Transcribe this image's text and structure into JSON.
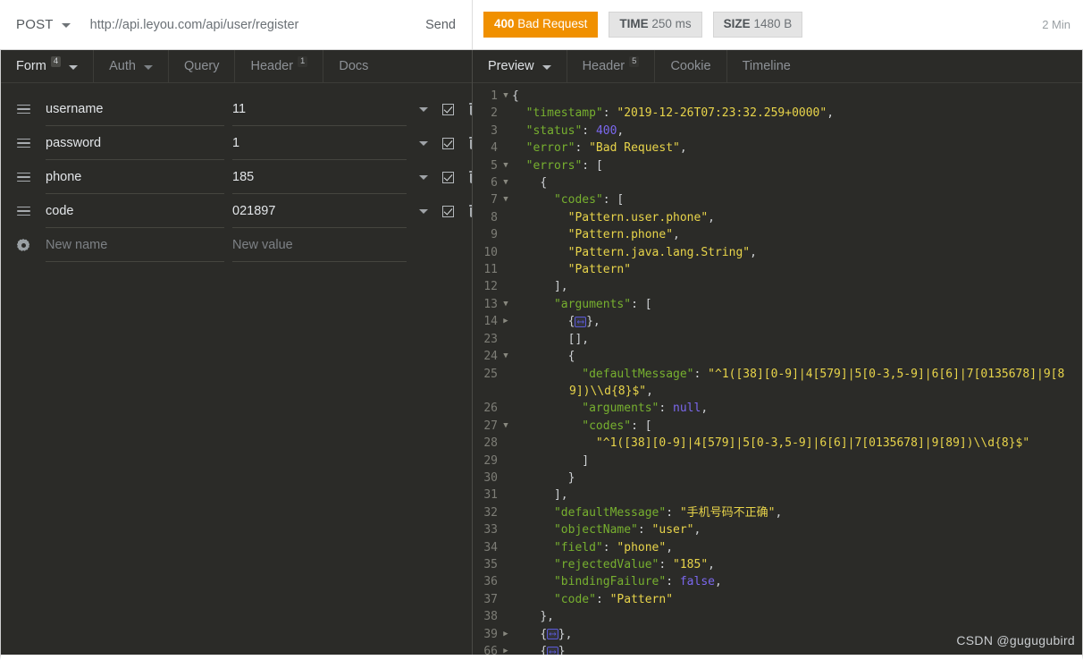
{
  "request": {
    "method": "POST",
    "url": "http://api.leyou.com/api/user/register",
    "send_label": "Send"
  },
  "response_status": {
    "status_code": "400",
    "status_text": "Bad Request",
    "time_label": "TIME",
    "time_value": "250 ms",
    "size_label": "SIZE",
    "size_value": "1480 B",
    "time_ago": "2 Min",
    "status_color": "#F09000"
  },
  "request_tabs": [
    {
      "label": "Form",
      "badge": "4",
      "caret": true,
      "active": true
    },
    {
      "label": "Auth",
      "badge": "",
      "caret": true,
      "active": false
    },
    {
      "label": "Query",
      "badge": "",
      "caret": false,
      "active": false
    },
    {
      "label": "Header",
      "badge": "1",
      "caret": false,
      "active": false
    },
    {
      "label": "Docs",
      "badge": "",
      "caret": false,
      "active": false
    }
  ],
  "response_tabs": [
    {
      "label": "Preview",
      "badge": "",
      "caret": true,
      "active": true
    },
    {
      "label": "Header",
      "badge": "5",
      "caret": false,
      "active": false
    },
    {
      "label": "Cookie",
      "badge": "",
      "caret": false,
      "active": false
    },
    {
      "label": "Timeline",
      "badge": "",
      "caret": false,
      "active": false
    }
  ],
  "form_rows": [
    {
      "name": "username",
      "value": "11",
      "enabled": true
    },
    {
      "name": "password",
      "value": "1",
      "enabled": true
    },
    {
      "name": "phone",
      "value": "185",
      "enabled": true
    },
    {
      "name": "code",
      "value": "021897",
      "enabled": true
    }
  ],
  "form_new_row": {
    "name_placeholder": "New name",
    "value_placeholder": "New value"
  },
  "json_lines": [
    {
      "num": "1",
      "fold": "down",
      "indent": 0,
      "parts": [
        {
          "t": "{",
          "c": "p"
        }
      ]
    },
    {
      "num": "2",
      "fold": "",
      "indent": 1,
      "parts": [
        {
          "t": "\"timestamp\"",
          "c": "k"
        },
        {
          "t": ": ",
          "c": "p"
        },
        {
          "t": "\"2019-12-26T07:23:32.259+0000\"",
          "c": "s"
        },
        {
          "t": ",",
          "c": "p"
        }
      ]
    },
    {
      "num": "3",
      "fold": "",
      "indent": 1,
      "parts": [
        {
          "t": "\"status\"",
          "c": "k"
        },
        {
          "t": ": ",
          "c": "p"
        },
        {
          "t": "400",
          "c": "n"
        },
        {
          "t": ",",
          "c": "p"
        }
      ]
    },
    {
      "num": "4",
      "fold": "",
      "indent": 1,
      "parts": [
        {
          "t": "\"error\"",
          "c": "k"
        },
        {
          "t": ": ",
          "c": "p"
        },
        {
          "t": "\"Bad Request\"",
          "c": "s"
        },
        {
          "t": ",",
          "c": "p"
        }
      ]
    },
    {
      "num": "5",
      "fold": "down",
      "indent": 1,
      "parts": [
        {
          "t": "\"errors\"",
          "c": "k"
        },
        {
          "t": ": ",
          "c": "p"
        },
        {
          "t": "[",
          "c": "p"
        }
      ]
    },
    {
      "num": "6",
      "fold": "down",
      "indent": 2,
      "parts": [
        {
          "t": "{",
          "c": "p"
        }
      ]
    },
    {
      "num": "7",
      "fold": "down",
      "indent": 3,
      "parts": [
        {
          "t": "\"codes\"",
          "c": "k"
        },
        {
          "t": ": ",
          "c": "p"
        },
        {
          "t": "[",
          "c": "p"
        }
      ]
    },
    {
      "num": "8",
      "fold": "",
      "indent": 4,
      "parts": [
        {
          "t": "\"Pattern.user.phone\"",
          "c": "s"
        },
        {
          "t": ",",
          "c": "p"
        }
      ]
    },
    {
      "num": "9",
      "fold": "",
      "indent": 4,
      "parts": [
        {
          "t": "\"Pattern.phone\"",
          "c": "s"
        },
        {
          "t": ",",
          "c": "p"
        }
      ]
    },
    {
      "num": "10",
      "fold": "",
      "indent": 4,
      "parts": [
        {
          "t": "\"Pattern.java.lang.String\"",
          "c": "s"
        },
        {
          "t": ",",
          "c": "p"
        }
      ]
    },
    {
      "num": "11",
      "fold": "",
      "indent": 4,
      "parts": [
        {
          "t": "\"Pattern\"",
          "c": "s"
        }
      ]
    },
    {
      "num": "12",
      "fold": "",
      "indent": 3,
      "parts": [
        {
          "t": "],",
          "c": "p"
        }
      ]
    },
    {
      "num": "13",
      "fold": "down",
      "indent": 3,
      "parts": [
        {
          "t": "\"arguments\"",
          "c": "k"
        },
        {
          "t": ": ",
          "c": "p"
        },
        {
          "t": "[",
          "c": "p"
        }
      ]
    },
    {
      "num": "14",
      "fold": "right",
      "indent": 4,
      "parts": [
        {
          "t": "{",
          "c": "p"
        },
        {
          "t": "FOLD",
          "c": "fold"
        },
        {
          "t": "},",
          "c": "p"
        }
      ]
    },
    {
      "num": "23",
      "fold": "",
      "indent": 4,
      "parts": [
        {
          "t": "[],",
          "c": "p"
        }
      ]
    },
    {
      "num": "24",
      "fold": "down",
      "indent": 4,
      "parts": [
        {
          "t": "{",
          "c": "p"
        }
      ]
    },
    {
      "num": "25",
      "fold": "",
      "indent": 5,
      "wrap": true,
      "parts": [
        {
          "t": "\"defaultMessage\"",
          "c": "k"
        },
        {
          "t": ": ",
          "c": "p"
        },
        {
          "t": "\"^1([38][0-9]|4[579]|5[0-3,5-9]|6[6]|7[0135678]|9[89])\\\\d{8}$\"",
          "c": "s"
        },
        {
          "t": ",",
          "c": "p"
        }
      ]
    },
    {
      "num": "26",
      "fold": "",
      "indent": 5,
      "parts": [
        {
          "t": "\"arguments\"",
          "c": "k"
        },
        {
          "t": ": ",
          "c": "p"
        },
        {
          "t": "null",
          "c": "n"
        },
        {
          "t": ",",
          "c": "p"
        }
      ]
    },
    {
      "num": "27",
      "fold": "down",
      "indent": 5,
      "parts": [
        {
          "t": "\"codes\"",
          "c": "k"
        },
        {
          "t": ": ",
          "c": "p"
        },
        {
          "t": "[",
          "c": "p"
        }
      ]
    },
    {
      "num": "28",
      "fold": "",
      "indent": 6,
      "nowrap": true,
      "parts": [
        {
          "t": "\"^1([38][0-9]|4[579]|5[0-3,5-9]|6[6]|7[0135678]|9[89])\\\\d{8}$\"",
          "c": "s"
        }
      ]
    },
    {
      "num": "29",
      "fold": "",
      "indent": 5,
      "parts": [
        {
          "t": "]",
          "c": "p"
        }
      ]
    },
    {
      "num": "30",
      "fold": "",
      "indent": 4,
      "parts": [
        {
          "t": "}",
          "c": "p"
        }
      ]
    },
    {
      "num": "31",
      "fold": "",
      "indent": 3,
      "parts": [
        {
          "t": "],",
          "c": "p"
        }
      ]
    },
    {
      "num": "32",
      "fold": "",
      "indent": 3,
      "parts": [
        {
          "t": "\"defaultMessage\"",
          "c": "k"
        },
        {
          "t": ": ",
          "c": "p"
        },
        {
          "t": "\"手机号码不正确\"",
          "c": "s"
        },
        {
          "t": ",",
          "c": "p"
        }
      ]
    },
    {
      "num": "33",
      "fold": "",
      "indent": 3,
      "parts": [
        {
          "t": "\"objectName\"",
          "c": "k"
        },
        {
          "t": ": ",
          "c": "p"
        },
        {
          "t": "\"user\"",
          "c": "s"
        },
        {
          "t": ",",
          "c": "p"
        }
      ]
    },
    {
      "num": "34",
      "fold": "",
      "indent": 3,
      "parts": [
        {
          "t": "\"field\"",
          "c": "k"
        },
        {
          "t": ": ",
          "c": "p"
        },
        {
          "t": "\"phone\"",
          "c": "s"
        },
        {
          "t": ",",
          "c": "p"
        }
      ]
    },
    {
      "num": "35",
      "fold": "",
      "indent": 3,
      "parts": [
        {
          "t": "\"rejectedValue\"",
          "c": "k"
        },
        {
          "t": ": ",
          "c": "p"
        },
        {
          "t": "\"185\"",
          "c": "s"
        },
        {
          "t": ",",
          "c": "p"
        }
      ]
    },
    {
      "num": "36",
      "fold": "",
      "indent": 3,
      "parts": [
        {
          "t": "\"bindingFailure\"",
          "c": "k"
        },
        {
          "t": ": ",
          "c": "p"
        },
        {
          "t": "false",
          "c": "n"
        },
        {
          "t": ",",
          "c": "p"
        }
      ]
    },
    {
      "num": "37",
      "fold": "",
      "indent": 3,
      "parts": [
        {
          "t": "\"code\"",
          "c": "k"
        },
        {
          "t": ": ",
          "c": "p"
        },
        {
          "t": "\"Pattern\"",
          "c": "s"
        }
      ]
    },
    {
      "num": "38",
      "fold": "",
      "indent": 2,
      "parts": [
        {
          "t": "},",
          "c": "p"
        }
      ]
    },
    {
      "num": "39",
      "fold": "right",
      "indent": 2,
      "parts": [
        {
          "t": "{",
          "c": "p"
        },
        {
          "t": "FOLD",
          "c": "fold"
        },
        {
          "t": "},",
          "c": "p"
        }
      ]
    },
    {
      "num": "66",
      "fold": "right",
      "indent": 2,
      "parts": [
        {
          "t": "{",
          "c": "p"
        },
        {
          "t": "FOLD",
          "c": "fold"
        },
        {
          "t": "}",
          "c": "p"
        }
      ]
    }
  ],
  "watermark": "CSDN @gugugubird"
}
